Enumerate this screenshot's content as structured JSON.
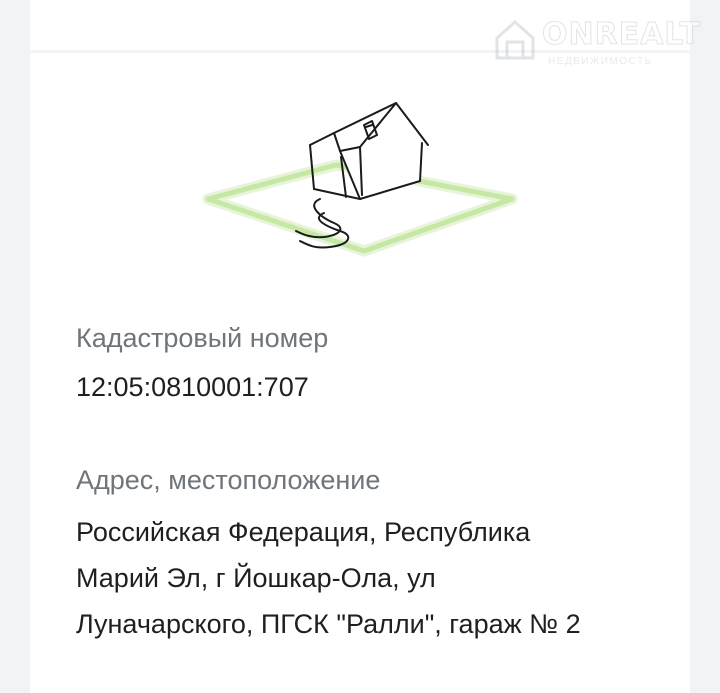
{
  "watermark": {
    "brand": "ONREALT",
    "tagline": "НЕДВИЖИМОСТЬ"
  },
  "illustration": {
    "icon": "house-on-land-plot-icon",
    "plot_color": "#c6e8a4"
  },
  "cadastral": {
    "label": "Кадастровый номер",
    "value": "12:05:0810001:707"
  },
  "address": {
    "label": "Адрес, местоположение",
    "lines": [
      "Российская Федерация, Республика",
      "Марий Эл, г Йошкар-Ола, ул",
      "Луначарского, ПГСК \"Ралли\", гараж № 2"
    ]
  }
}
